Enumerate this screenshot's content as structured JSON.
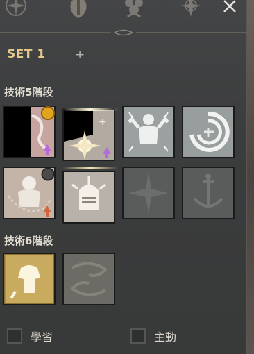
{
  "set": {
    "label": "SET 1",
    "add_symbol": "+"
  },
  "tiers": [
    {
      "title": "技術5階段"
    },
    {
      "title": "技術6階段"
    }
  ],
  "options": {
    "learn_label": "學習",
    "active_label": "主動"
  },
  "colors": {
    "accent_gold": "#e7c98d",
    "arrow_purple": "#b56ad8",
    "arrow_orange": "#d0673c"
  },
  "icons": [
    "compass-icon",
    "crest-icon",
    "ornament-icon",
    "star-icon",
    "close-icon",
    "warrior-flex-icon",
    "spiral-icon",
    "burst-icon",
    "anchor-icon",
    "armor-icon",
    "swirl-icon",
    "knight-helmet-icon",
    "chained-fighter-icon"
  ]
}
